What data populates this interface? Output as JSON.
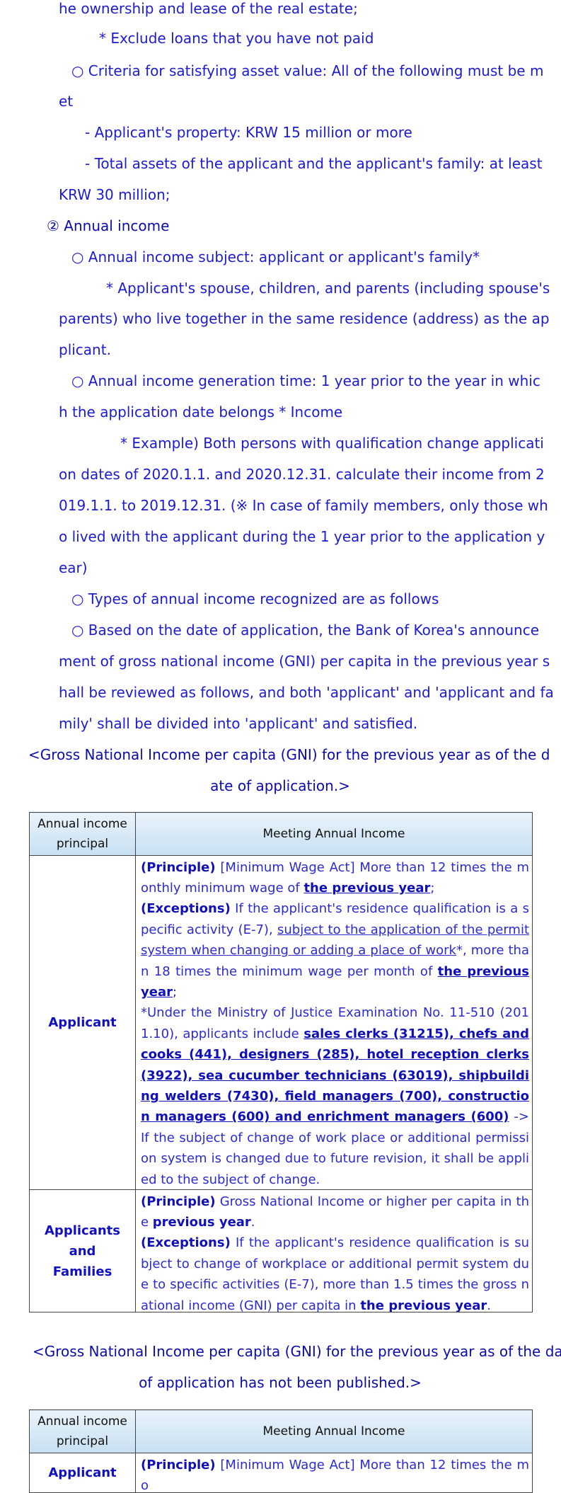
{
  "top_text": [
    "he ownership and lease of the real estate;",
    "* Exclude loans that you have not paid",
    "○ Criteria for satisfying asset value: All of the following must be m",
    "et",
    "- Applicant's property: KRW 15 million or more",
    "- Total assets of the applicant and the applicant's family: at least",
    "KRW 30 million;",
    "② Annual income",
    "○ Annual income subject: applicant or applicant's family*",
    "* Applicant's spouse, children, and parents (including spouse's",
    "parents) who live together in the same residence (address) as the ap",
    "plicant.",
    "○ Annual income generation time: 1 year prior to the year in whic",
    "h the application date belongs * Income",
    "* Example) Both persons with qualification change applicati",
    "on dates of 2020.1.1. and 2020.12.31. calculate their income from 2",
    "019.1.1. to 2019.12.31. (※ In case of family members, only those wh",
    "o lived with the applicant during the 1 year prior to the application y",
    "ear)",
    "○ Types of annual income recognized are as follows",
    "○ Based on the date of application, the Bank of Korea's announce",
    "ment of gross national income (GNI) per capita in the previous year s",
    "hall be reviewed as follows, and both 'applicant' and 'applicant and fa",
    "mily' shall be divided into 'applicant' and satisfied."
  ],
  "heading1": [
    "<Gross National Income per capita (GNI) for the previous year as of the d",
    "ate of application.>"
  ],
  "table1": {
    "col1_header": [
      "Annual income",
      "principal"
    ],
    "col2_header": "Meeting Annual Income",
    "row1_label": "Applicant",
    "row1": {
      "p1_lead": "(Principle)",
      "p1_text": " [Minimum Wage Act] More than 12 times the monthly minimum wage of ",
      "p1_emph": "the previous year",
      "p1_end": ";",
      "p2_lead": "(Exceptions)",
      "p2_text": " If the applicant's residence qualification is a specific activity (E-7), ",
      "p2_underline": "subject to the application of the permit system when changing or adding a place of work",
      "p2_text2": "*, more than 18 times the minimum wage per month of ",
      "p2_emph": "the previous year",
      "p2_end": ";",
      "p3_text": " *Under the Ministry of Justice Examination No. 11-510 (2011.10), applicants include ",
      "p3_emph": "sales clerks (31215), chefs and cooks (441), designers (285), hotel reception clerks (3922), sea cucumber technicians (63019), shipbuilding welders (7430), field managers (700), construction managers (600) and enrichment managers (600)",
      "p3_end": " -> If the subject of change of work place or additional permission system is changed due to future revision, it shall be applied to the subject of change."
    },
    "row2_label": [
      "Applicants and",
      "Families"
    ],
    "row2": {
      "p1_lead": "(Principle)",
      "p1_text": " Gross National Income or higher per capita in the ",
      "p1_emph": "previous year",
      "p1_end": ".",
      "p2_lead": "(Exceptions)",
      "p2_text": " If the applicant's residence qualification is subject to change of workplace or additional permit system due to specific activities (E-7), more than 1.5 times the gross national income (GNI) per capita in ",
      "p2_emph": "the previous year",
      "p2_end": "."
    }
  },
  "heading2": [
    "<Gross National Income per capita (GNI) for the previous year as of the date",
    "of application has not been published.>"
  ],
  "table2": {
    "col1_header": [
      "Annual income",
      "principal"
    ],
    "col2_header": "Meeting Annual Income",
    "row1_label": "Applicant",
    "row1": {
      "p1_lead": "(Principle)",
      "p1_text": " [Minimum Wage Act] More than 12 times the mo"
    }
  }
}
